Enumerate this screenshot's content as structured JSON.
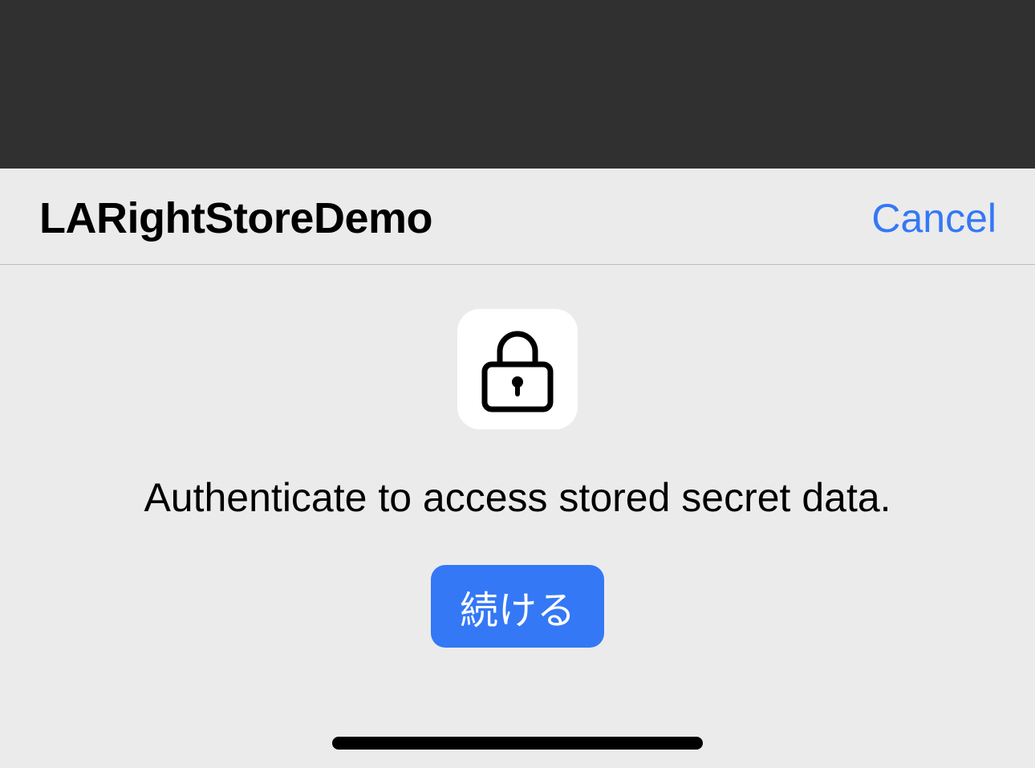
{
  "header": {
    "app_title": "LARightStoreDemo",
    "cancel_label": "Cancel"
  },
  "auth_prompt": {
    "icon": "lock-icon",
    "message": "Authenticate to access stored secret data.",
    "continue_label": "続ける"
  },
  "colors": {
    "accent": "#3478f6",
    "sheet_background": "#ebebec",
    "backdrop": "#303030"
  }
}
